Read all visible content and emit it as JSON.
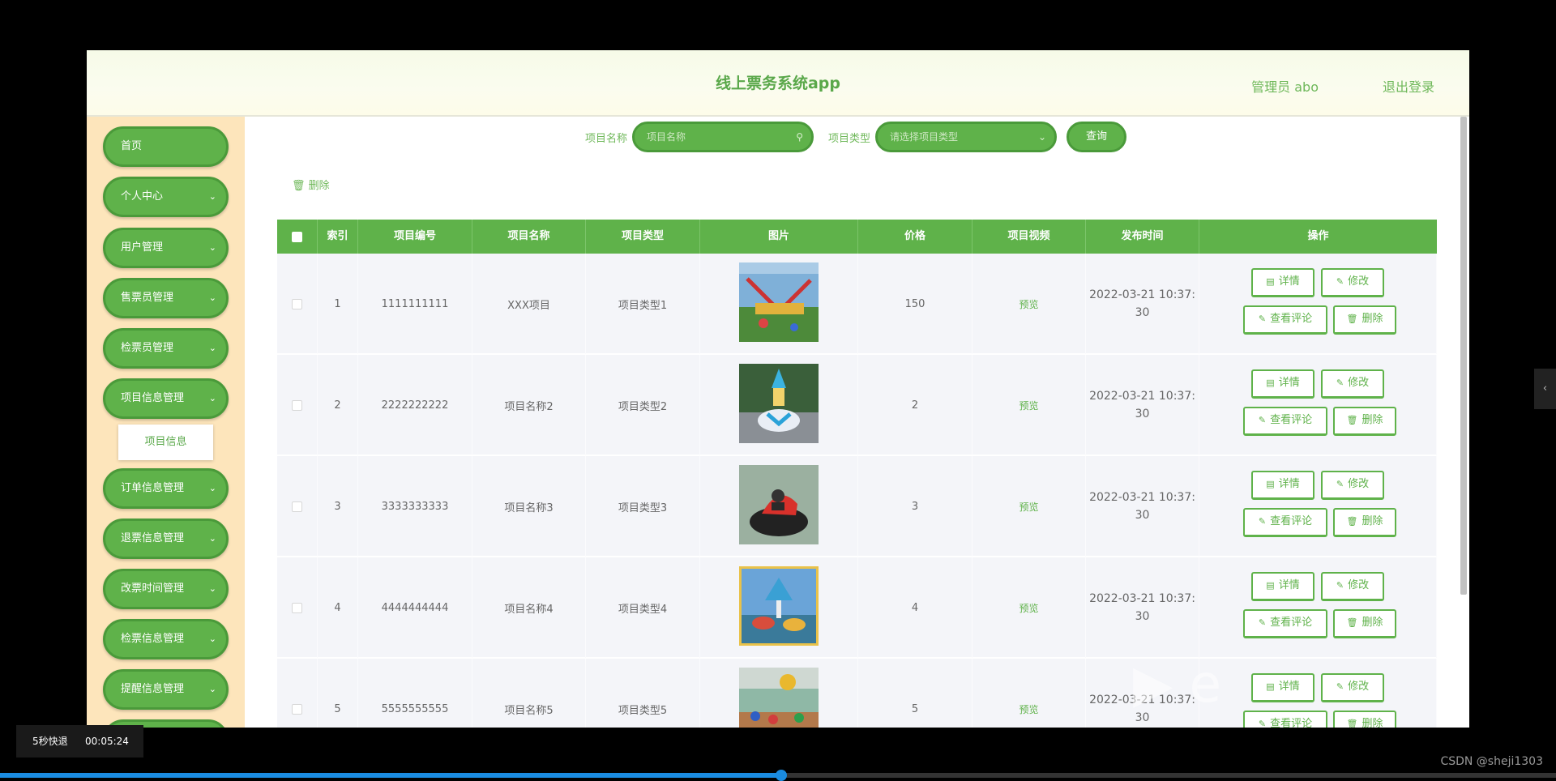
{
  "header": {
    "title": "线上票务系统app",
    "user": "管理员 abo",
    "logout": "退出登录"
  },
  "sidebar": {
    "items": [
      {
        "label": "首页",
        "chevron": false
      },
      {
        "label": "个人中心",
        "chevron": true
      },
      {
        "label": "用户管理",
        "chevron": true
      },
      {
        "label": "售票员管理",
        "chevron": true
      },
      {
        "label": "检票员管理",
        "chevron": true
      },
      {
        "label": "项目信息管理",
        "chevron": true
      },
      {
        "label": "订单信息管理",
        "chevron": true
      },
      {
        "label": "退票信息管理",
        "chevron": true
      },
      {
        "label": "改票时间管理",
        "chevron": true
      },
      {
        "label": "检票信息管理",
        "chevron": true
      },
      {
        "label": "提醒信息管理",
        "chevron": true
      }
    ],
    "submenu": "项目信息"
  },
  "search": {
    "name_label": "项目名称",
    "name_placeholder": "项目名称",
    "type_label": "项目类型",
    "type_placeholder": "请选择项目类型",
    "query_button": "查询",
    "icons": {
      "search": "search-icon",
      "dropdown": "chevron-down-icon"
    }
  },
  "toolbar": {
    "delete_label": "删除"
  },
  "table": {
    "headers": [
      "索引",
      "项目编号",
      "项目名称",
      "项目类型",
      "图片",
      "价格",
      "项目视频",
      "发布时间",
      "操作"
    ],
    "rows": [
      {
        "index": "1",
        "code": "1111111111",
        "name": "XXX项目",
        "type": "项目类型1",
        "price": "150",
        "video": "预览",
        "time1": "2022-03-21 10:37:",
        "time2": "30",
        "image": "pirate-ship-ride"
      },
      {
        "index": "2",
        "code": "2222222222",
        "name": "项目名称2",
        "type": "项目类型2",
        "price": "2",
        "video": "预览",
        "time1": "2022-03-21 10:37:",
        "time2": "30",
        "image": "teacup-ride"
      },
      {
        "index": "3",
        "code": "3333333333",
        "name": "项目名称3",
        "type": "项目类型3",
        "price": "3",
        "video": "预览",
        "time1": "2022-03-21 10:37:",
        "time2": "30",
        "image": "bumper-boat"
      },
      {
        "index": "4",
        "code": "4444444444",
        "name": "项目名称4",
        "type": "项目类型4",
        "price": "4",
        "video": "预览",
        "time1": "2022-03-21 10:37:",
        "time2": "30",
        "image": "carousel-ride"
      },
      {
        "index": "5",
        "code": "5555555555",
        "name": "项目名称5",
        "type": "项目类型5",
        "price": "5",
        "video": "预览",
        "time1": "2022-03-21 10:37:",
        "time2": "30",
        "image": "park-crowd"
      }
    ],
    "actions": {
      "detail": "详情",
      "edit": "修改",
      "review": "查看评论",
      "delete": "删除"
    }
  },
  "player": {
    "skip_label": "5秒快退",
    "time": "00:05:24",
    "progress": 0.502,
    "credit": "CSDN @sheji1303"
  },
  "colors": {
    "accent": "#5fb24a",
    "sidebar_bg": "#fde5bb",
    "table_row": "#f4f5f9"
  }
}
